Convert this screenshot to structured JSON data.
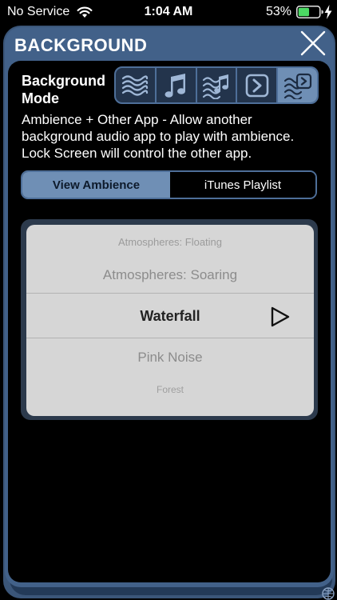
{
  "status_bar": {
    "carrier": "No Service",
    "time": "1:04 AM",
    "battery_percent": "53%",
    "battery_level": 0.53,
    "battery_color": "#4cd964",
    "charging": true
  },
  "panel": {
    "title": "BACKGROUND",
    "close_icon": "close-icon"
  },
  "mode": {
    "label_line1": "Background",
    "label_line2": "Mode",
    "options": [
      {
        "icon": "waves-icon",
        "selected": false
      },
      {
        "icon": "music-note-icon",
        "selected": false
      },
      {
        "icon": "waves-music-icon",
        "selected": false
      },
      {
        "icon": "app-chevron-icon",
        "selected": false
      },
      {
        "icon": "waves-app-icon",
        "selected": true
      }
    ],
    "description_lines": [
      "Ambience + Other App - Allow another",
      "background audio app to play with ambience.",
      "Lock Screen will control the other app."
    ]
  },
  "view_toggle": {
    "ambience_label": "View Ambience",
    "playlist_label": "iTunes Playlist",
    "selected": "View Ambience"
  },
  "picker": {
    "rows": [
      "Atmospheres: Floating",
      "Atmospheres: Soaring",
      "Waterfall",
      "Pink Noise",
      "Forest"
    ],
    "selected": "Waterfall"
  },
  "colors": {
    "panel_blue": "#426189",
    "accent_blue": "#6f8fb5",
    "picker_bg": "#d6d6d6"
  }
}
